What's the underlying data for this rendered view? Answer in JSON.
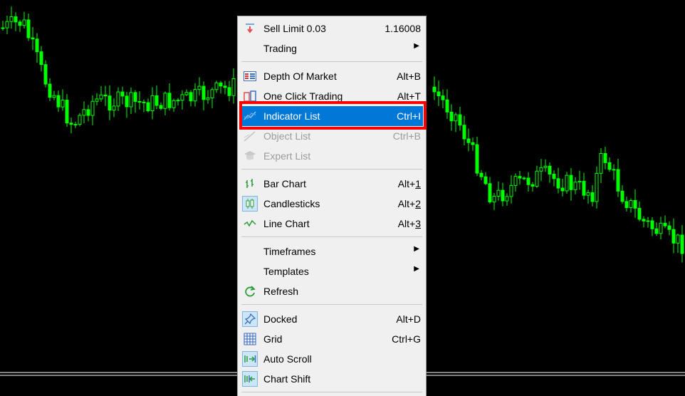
{
  "chart": {
    "background": "#000000",
    "candle_color": "#00ff00",
    "grid_line_color": "#ffffff"
  },
  "menu": {
    "items": [
      {
        "label": "Sell Limit 0.03",
        "value": "1.16008",
        "icon": "sell-limit-icon"
      },
      {
        "label": "Trading",
        "submenu": true
      },
      {
        "label": "Depth Of Market",
        "shortcut": "Alt+B",
        "icon": "depth-of-market-icon"
      },
      {
        "label": "One Click Trading",
        "shortcut": "Alt+T",
        "icon": "one-click-trading-icon"
      },
      {
        "label": "Indicator List",
        "shortcut": "Ctrl+I",
        "icon": "indicator-list-icon",
        "selected": true
      },
      {
        "label": "Object List",
        "shortcut": "Ctrl+B",
        "icon": "object-list-icon",
        "disabled": true
      },
      {
        "label": "Expert List",
        "icon": "expert-list-icon",
        "disabled": true
      },
      {
        "label": "Bar Chart",
        "shortcut_prefix": "Alt+",
        "shortcut_key": "1",
        "icon": "bar-chart-icon"
      },
      {
        "label": "Candlesticks",
        "shortcut_prefix": "Alt+",
        "shortcut_key": "2",
        "icon": "candlesticks-icon",
        "checked": true
      },
      {
        "label": "Line Chart",
        "shortcut_prefix": "Alt+",
        "shortcut_key": "3",
        "icon": "line-chart-icon"
      },
      {
        "label": "Timeframes",
        "submenu": true
      },
      {
        "label": "Templates",
        "submenu": true
      },
      {
        "label": "Refresh",
        "icon": "refresh-icon"
      },
      {
        "label": "Docked",
        "shortcut": "Alt+D",
        "icon": "pin-icon",
        "checked": true
      },
      {
        "label": "Grid",
        "shortcut": "Ctrl+G",
        "icon": "grid-icon"
      },
      {
        "label": "Auto Scroll",
        "icon": "auto-scroll-icon",
        "checked": true
      },
      {
        "label": "Chart Shift",
        "icon": "chart-shift-icon",
        "checked": true
      }
    ],
    "submenu_arrow": "▶",
    "selected_color": "#0078d7",
    "highlight_box_color": "#ff0000"
  }
}
